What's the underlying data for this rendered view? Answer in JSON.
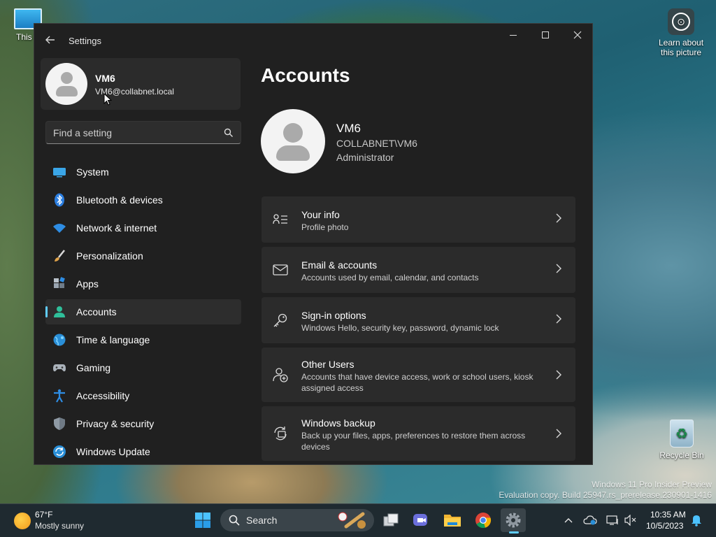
{
  "desktop": {
    "this_pc_label": "This P",
    "learn_label": "Learn about this picture",
    "recycle_label": "Recycle Bin",
    "watermark_line1": "Windows 11 Pro Insider Preview",
    "watermark_line2": "Evaluation copy. Build 25947.rs_prerelease.230901-1416"
  },
  "window": {
    "title": "Settings",
    "user": {
      "name": "VM6",
      "email": "VM6@collabnet.local"
    },
    "search": {
      "placeholder": "Find a setting",
      "value": ""
    },
    "nav": [
      {
        "label": "System",
        "icon": "system-icon"
      },
      {
        "label": "Bluetooth & devices",
        "icon": "bluetooth-icon"
      },
      {
        "label": "Network & internet",
        "icon": "wifi-icon"
      },
      {
        "label": "Personalization",
        "icon": "brush-icon"
      },
      {
        "label": "Apps",
        "icon": "apps-icon"
      },
      {
        "label": "Accounts",
        "icon": "accounts-icon",
        "active": true
      },
      {
        "label": "Time & language",
        "icon": "globe-icon"
      },
      {
        "label": "Gaming",
        "icon": "gamepad-icon"
      },
      {
        "label": "Accessibility",
        "icon": "accessibility-icon"
      },
      {
        "label": "Privacy & security",
        "icon": "shield-icon"
      },
      {
        "label": "Windows Update",
        "icon": "update-icon"
      }
    ],
    "page": {
      "title": "Accounts",
      "account_name": "VM6",
      "account_domain": "COLLABNET\\VM6",
      "account_role": "Administrator",
      "cards": [
        {
          "title": "Your info",
          "desc": "Profile photo",
          "icon": "your-info-icon"
        },
        {
          "title": "Email & accounts",
          "desc": "Accounts used by email, calendar, and contacts",
          "icon": "mail-icon"
        },
        {
          "title": "Sign-in options",
          "desc": "Windows Hello, security key, password, dynamic lock",
          "icon": "key-icon"
        },
        {
          "title": "Other Users",
          "desc": "Accounts that have device access, work or school users, kiosk assigned access",
          "icon": "add-user-icon"
        },
        {
          "title": "Windows backup",
          "desc": "Back up your files, apps, preferences to restore them across devices",
          "icon": "backup-icon"
        }
      ]
    }
  },
  "taskbar": {
    "weather_temp": "67°F",
    "weather_condition": "Mostly sunny",
    "search_label": "Search",
    "clock_time": "10:35 AM",
    "clock_date": "10/5/2023"
  },
  "colors": {
    "accent": "#60cdff",
    "window_bg": "#202020",
    "card_bg": "#2b2b2b"
  }
}
